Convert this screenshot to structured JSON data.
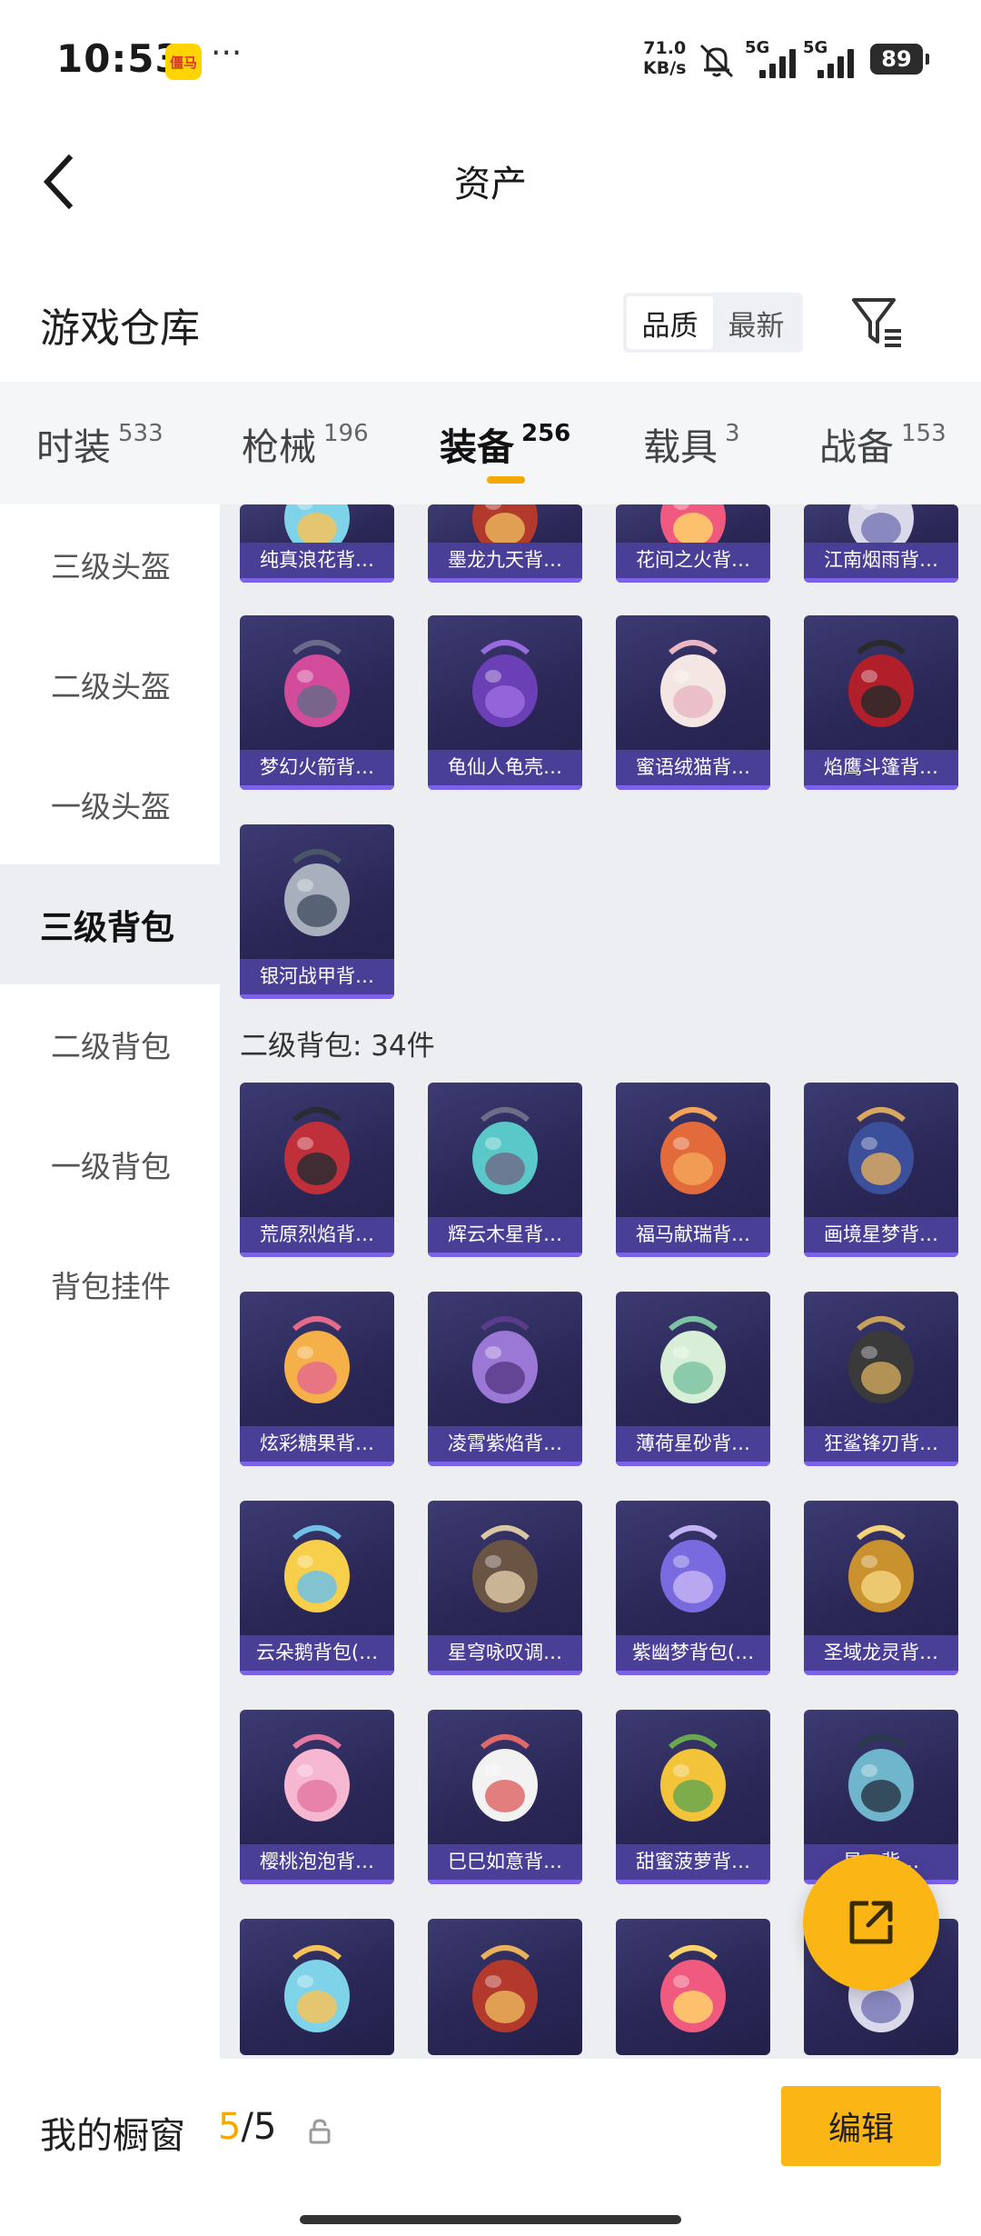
{
  "status_bar": {
    "time": "10:53",
    "app_icon_text": "僵马",
    "more": "···",
    "speed_value": "71.0",
    "speed_unit": "KB/s",
    "net1": "5G",
    "net2": "5G",
    "battery": "89"
  },
  "header": {
    "title": "资产"
  },
  "section": {
    "title": "游戏仓库",
    "sort_quality": "品质",
    "sort_newest": "最新"
  },
  "tabs": [
    {
      "label": "时装",
      "count": "533"
    },
    {
      "label": "枪械",
      "count": "196"
    },
    {
      "label": "装备",
      "count": "256"
    },
    {
      "label": "载具",
      "count": "3"
    },
    {
      "label": "战备",
      "count": "153"
    }
  ],
  "sidebar": [
    {
      "label": "三级头盔"
    },
    {
      "label": "二级头盔"
    },
    {
      "label": "一级头盔"
    },
    {
      "label": "三级背包"
    },
    {
      "label": "二级背包"
    },
    {
      "label": "一级背包"
    },
    {
      "label": "背包挂件"
    }
  ],
  "level3_items": [
    {
      "name": "纯真浪花背…"
    },
    {
      "name": "墨龙九天背…"
    },
    {
      "name": "花间之火背…"
    },
    {
      "name": "江南烟雨背…"
    },
    {
      "name": "梦幻火箭背…"
    },
    {
      "name": "龟仙人龟壳…"
    },
    {
      "name": "蜜语绒猫背…"
    },
    {
      "name": "焰鹰斗篷背…"
    },
    {
      "name": "银河战甲背…"
    }
  ],
  "level2_group": {
    "label": "二级背包: 34件"
  },
  "level2_items": [
    {
      "name": "荒原烈焰背…"
    },
    {
      "name": "辉云木星背…"
    },
    {
      "name": "福马献瑞背…"
    },
    {
      "name": "画境星梦背…"
    },
    {
      "name": "炫彩糖果背…"
    },
    {
      "name": "凌霄紫焰背…"
    },
    {
      "name": "薄荷星砂背…"
    },
    {
      "name": "狂鲨锋刃背…"
    },
    {
      "name": "云朵鹅背包(…"
    },
    {
      "name": "星穹咏叹调…"
    },
    {
      "name": "紫幽梦背包(…"
    },
    {
      "name": "圣域龙灵背…"
    },
    {
      "name": "樱桃泡泡背…"
    },
    {
      "name": "巳巳如意背…"
    },
    {
      "name": "甜蜜菠萝背…"
    },
    {
      "name": "星…背…"
    }
  ],
  "bottom": {
    "window_label": "我的橱窗",
    "count_current": "5",
    "count_sep": "/",
    "count_total": "5",
    "edit": "编辑"
  },
  "colors": {
    "accent": "#fbb615",
    "card_bg": "#2a2756",
    "card_label": "#4a3f97"
  }
}
